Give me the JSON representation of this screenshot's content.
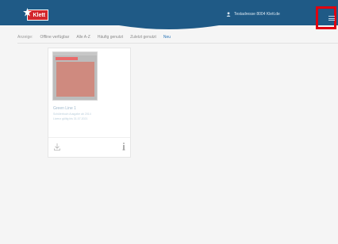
{
  "header": {
    "logo_text": "Klett",
    "user_label": "Testadresse 8004 Klett.de",
    "icons": {
      "user": "user-icon",
      "menu": "menu-icon",
      "logo": "klett-star-icon"
    },
    "colors": {
      "bar": "#1f5a86",
      "logo": "#d2262c",
      "highlight": "#e0000f"
    }
  },
  "filters": {
    "label": "Anzeige:",
    "items": [
      {
        "label": "Offline verfügbar"
      },
      {
        "label": "Alle A-Z"
      },
      {
        "label": "Häufig genutzt"
      },
      {
        "label": "Zuletzt genutzt"
      },
      {
        "label": "Neu",
        "active": true
      }
    ]
  },
  "card": {
    "title": "Green Line 1",
    "subtitle": "Schülerbuch Ausgabe ab 2014",
    "meta": "Lizenz gültig bis 31.07.2021",
    "icons": {
      "download": "download-icon",
      "info": "info-icon"
    }
  }
}
